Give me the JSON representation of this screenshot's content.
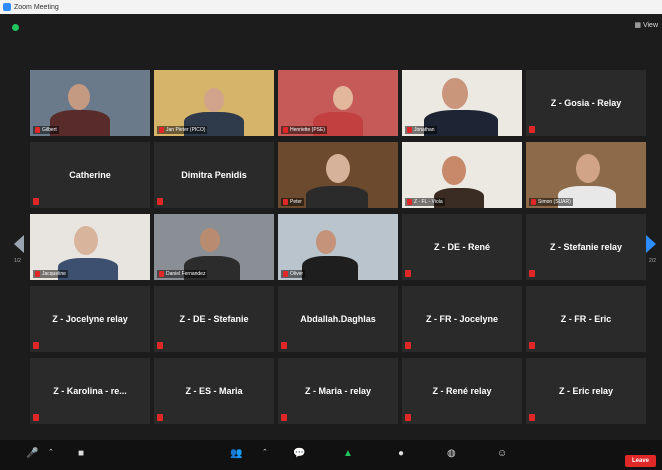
{
  "window": {
    "title": "Zoom Meeting"
  },
  "top": {
    "view_label": "View"
  },
  "participants": [
    {
      "name": "",
      "label": "Gilbert",
      "video": true,
      "scene": "a"
    },
    {
      "name": "",
      "label": "Jan Pieter (PICO)",
      "video": true,
      "scene": "b"
    },
    {
      "name": "",
      "label": "Henriette (PSE)",
      "video": true,
      "scene": "c"
    },
    {
      "name": "",
      "label": "Jonathan",
      "video": true,
      "scene": "d",
      "speaking": true
    },
    {
      "name": "Z - Gosia - Relay",
      "label": "",
      "video": false
    },
    {
      "name": "Catherine",
      "label": "",
      "video": false
    },
    {
      "name": "Dimitra Penidis",
      "label": "",
      "video": false
    },
    {
      "name": "",
      "label": "Peter",
      "video": true,
      "scene": "e"
    },
    {
      "name": "",
      "label": "Z - FL - Viola",
      "video": true,
      "scene": "f"
    },
    {
      "name": "",
      "label": "Simon (SUAR)",
      "video": true,
      "scene": "g"
    },
    {
      "name": "",
      "label": "Jacqueline",
      "video": true,
      "scene": "h"
    },
    {
      "name": "",
      "label": "Daniel Fernandez",
      "video": true,
      "scene": "i"
    },
    {
      "name": "",
      "label": "Oliver",
      "video": true,
      "scene": "j"
    },
    {
      "name": "Z - DE - René",
      "label": "",
      "video": false
    },
    {
      "name": "Z - Stefanie relay",
      "label": "",
      "video": false
    },
    {
      "name": "Z - Jocelyne relay",
      "label": "",
      "video": false
    },
    {
      "name": "Z - DE - Stefanie",
      "label": "",
      "video": false
    },
    {
      "name": "Abdallah.Daghlas",
      "label": "",
      "video": false
    },
    {
      "name": "Z - FR - Jocelyne",
      "label": "",
      "video": false
    },
    {
      "name": "Z - FR - Eric",
      "label": "",
      "video": false
    },
    {
      "name": "Z - Karolina - re...",
      "label": "",
      "video": false
    },
    {
      "name": "Z - ES - Maria",
      "label": "",
      "video": false
    },
    {
      "name": "Z - Maria - relay",
      "label": "",
      "video": false
    },
    {
      "name": "Z - René relay",
      "label": "",
      "video": false
    },
    {
      "name": "Z - Eric relay",
      "label": "",
      "video": false
    }
  ],
  "pager": {
    "left": "1/2",
    "right": "2/2"
  },
  "toolbar": {
    "leave_label": "Leave"
  },
  "colors": {
    "accent": "#2d8cff",
    "mute": "#e02828",
    "active_speaker": "#a8d26a"
  }
}
